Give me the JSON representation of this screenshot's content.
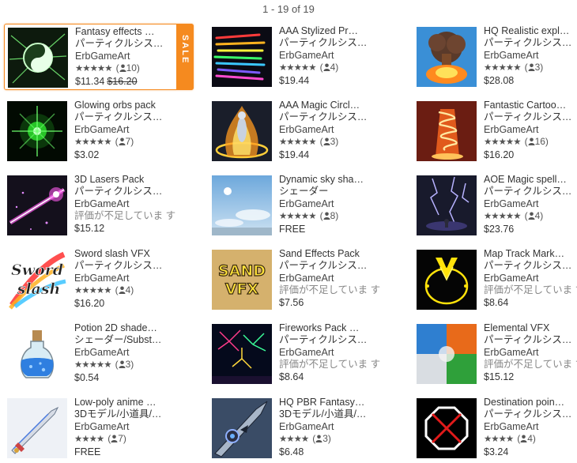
{
  "pagination": {
    "label": "1 - 19 of 19"
  },
  "sale_label": "SALE",
  "items": [
    {
      "title": "Fantasy effects …",
      "category": "パーティクルシス…",
      "publisher": "ErbGameArt",
      "stars": "★★★★★",
      "count": "10",
      "price": "$11.34",
      "old_price": "$16.20",
      "sale": true,
      "thumb": "fantasy-effects-thumbnail"
    },
    {
      "title": "AAA Stylized Pr…",
      "category": "パーティクルシス…",
      "publisher": "ErbGameArt",
      "stars": "★★★★★",
      "count": "4",
      "price": "$19.44",
      "thumb": "stylized-projectiles-thumbnail"
    },
    {
      "title": "HQ Realistic expl…",
      "category": "パーティクルシス…",
      "publisher": "ErbGameArt",
      "stars": "★★★★★",
      "count": "3",
      "price": "$28.08",
      "thumb": "explosion-thumbnail"
    },
    {
      "title": "Glowing orbs pack",
      "category": "パーティクルシス…",
      "publisher": "ErbGameArt",
      "stars": "★★★★★",
      "count": "7",
      "price": "$3.02",
      "thumb": "glowing-orb-thumbnail"
    },
    {
      "title": "AAA Magic Circl…",
      "category": "パーティクルシス…",
      "publisher": "ErbGameArt",
      "stars": "★★★★★",
      "count": "3",
      "price": "$19.44",
      "thumb": "magic-circle-thumbnail"
    },
    {
      "title": "Fantastic Cartoo…",
      "category": "パーティクルシス…",
      "publisher": "ErbGameArt",
      "stars": "★★★★★",
      "count": "16",
      "price": "$16.20",
      "thumb": "cartoon-tornado-thumbnail"
    },
    {
      "title": "3D Lasers Pack",
      "category": "パーティクルシス…",
      "publisher": "ErbGameArt",
      "no_rating": "評価が不足していま す",
      "price": "$15.12",
      "thumb": "laser-thumbnail"
    },
    {
      "title": "Dynamic sky sha…",
      "category": "シェーダー",
      "publisher": "ErbGameArt",
      "stars": "★★★★★",
      "count": "8",
      "price": "FREE",
      "thumb": "sky-thumbnail"
    },
    {
      "title": "AOE Magic spell…",
      "category": "パーティクルシス…",
      "publisher": "ErbGameArt",
      "stars": "★★★★★",
      "count": "4",
      "price": "$23.76",
      "thumb": "lightning-thumbnail"
    },
    {
      "title": "Sword slash VFX",
      "category": "パーティクルシス…",
      "publisher": "ErbGameArt",
      "stars": "★★★★★",
      "count": "4",
      "price": "$16.20",
      "thumb": "sword-slash-thumbnail",
      "thumb_text": [
        "Sword",
        "slash"
      ]
    },
    {
      "title": "Sand Effects Pack",
      "category": "パーティクルシス…",
      "publisher": "ErbGameArt",
      "no_rating": "評価が不足していま す",
      "price": "$7.56",
      "thumb": "sand-vfx-thumbnail",
      "thumb_text": [
        "SAND",
        "VFX"
      ]
    },
    {
      "title": "Map Track Mark…",
      "category": "パーティクルシス…",
      "publisher": "ErbGameArt",
      "no_rating": "評価が不足していま す",
      "price": "$8.64",
      "thumb": "map-track-thumbnail"
    },
    {
      "title": "Potion 2D shade…",
      "category": "シェーダー/Subst…",
      "publisher": "ErbGameArt",
      "stars": "★★★★★",
      "count": "3",
      "price": "$0.54",
      "thumb": "potion-thumbnail"
    },
    {
      "title": "Fireworks Pack …",
      "category": "パーティクルシス…",
      "publisher": "ErbGameArt",
      "no_rating": "評価が不足していま す",
      "price": "$8.64",
      "thumb": "fireworks-thumbnail"
    },
    {
      "title": "Elemental VFX",
      "category": "パーティクルシス…",
      "publisher": "ErbGameArt",
      "no_rating": "評価が不足していま す",
      "price": "$15.12",
      "thumb": "elemental-thumbnail"
    },
    {
      "title": "Low-poly anime …",
      "category": "3Dモデル/小道具/…",
      "publisher": "ErbGameArt",
      "stars": "★★★★",
      "count": "7",
      "price": "FREE",
      "thumb": "anime-sword-thumbnail"
    },
    {
      "title": "HQ PBR Fantasy…",
      "category": "3Dモデル/小道具/…",
      "publisher": "ErbGameArt",
      "stars": "★★★★",
      "count": "3",
      "price": "$6.48",
      "thumb": "fantasy-weapon-thumbnail"
    },
    {
      "title": "Destination poin…",
      "category": "パーティクルシス…",
      "publisher": "ErbGameArt",
      "stars": "★★★★",
      "count": "4",
      "price": "$3.24",
      "thumb": "destination-point-thumbnail"
    }
  ]
}
